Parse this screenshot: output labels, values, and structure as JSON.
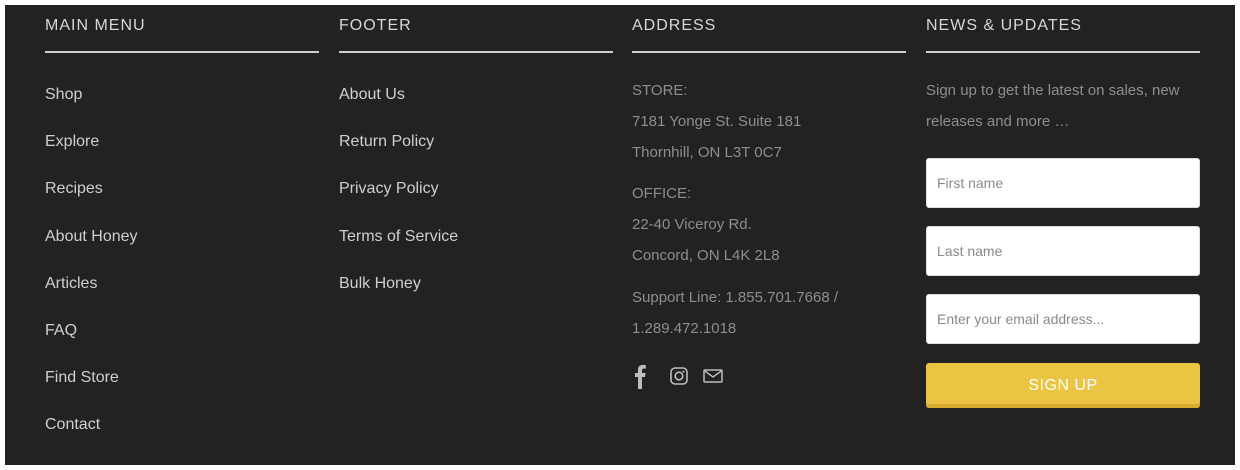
{
  "main_menu": {
    "title": "MAIN MENU",
    "items": [
      {
        "label": "Shop"
      },
      {
        "label": "Explore"
      },
      {
        "label": "Recipes"
      },
      {
        "label": "About Honey"
      },
      {
        "label": "Articles"
      },
      {
        "label": "FAQ"
      },
      {
        "label": "Find Store"
      },
      {
        "label": "Contact"
      }
    ]
  },
  "footer_menu": {
    "title": "FOOTER",
    "items": [
      {
        "label": "About Us"
      },
      {
        "label": "Return Policy"
      },
      {
        "label": "Privacy Policy"
      },
      {
        "label": "Terms of Service"
      },
      {
        "label": "Bulk Honey"
      }
    ]
  },
  "address": {
    "title": "ADDRESS",
    "store": {
      "heading": "STORE:",
      "line1": "7181 Yonge St. Suite 181",
      "line2": "Thornhill, ON L3T 0C7"
    },
    "office": {
      "heading": "OFFICE:",
      "line1": "22-40 Viceroy Rd.",
      "line2": "Concord, ON  L4K 2L8"
    },
    "support": {
      "line1": "Support Line: 1.855.701.7668 /",
      "line2": "1.289.472.1018"
    },
    "social_icons": [
      "facebook-icon",
      "instagram-icon",
      "email-icon"
    ]
  },
  "news": {
    "title": "NEWS & UPDATES",
    "description": "Sign up to get the latest on sales, new releases and more …",
    "first_name": {
      "placeholder": "First name",
      "value": ""
    },
    "last_name": {
      "placeholder": "Last name",
      "value": ""
    },
    "email": {
      "placeholder": "Enter your email address...",
      "value": ""
    },
    "signup_label": "SIGN UP"
  },
  "colors": {
    "background": "#222222",
    "accent": "#ecc443",
    "text_primary": "#cfcfcf",
    "text_muted": "#8e8e8e"
  }
}
